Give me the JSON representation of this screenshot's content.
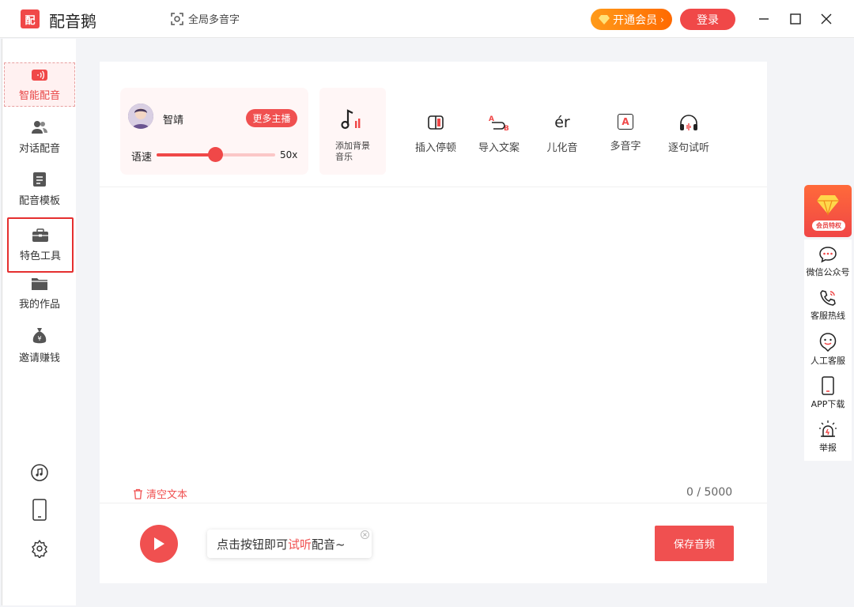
{
  "app": {
    "logo_text": "配",
    "title": "配音鹅"
  },
  "toolbar": {
    "multi_char_label": "全局多音字",
    "vip_label": "开通会员",
    "login_label": "登录"
  },
  "sidebar": {
    "items": [
      {
        "label": "智能配音"
      },
      {
        "label": "对话配音"
      },
      {
        "label": "配音模板"
      },
      {
        "label": "特色工具"
      },
      {
        "label": "我的作品"
      },
      {
        "label": "邀请赚钱"
      }
    ]
  },
  "voice": {
    "name": "智靖",
    "more_label": "更多主播",
    "speed_label": "语速",
    "speed_value": "50x",
    "speed_fraction": 0.5
  },
  "bgm": {
    "label": "添加背景音乐"
  },
  "tools": [
    {
      "label": "插入停顿"
    },
    {
      "label": "导入文案"
    },
    {
      "label": "儿化音",
      "glyph": "ér"
    },
    {
      "label": "多音字",
      "glyph": "A"
    },
    {
      "label": "逐句试听"
    }
  ],
  "editor": {
    "clear_label": "清空文本",
    "counter": "0 / 5000"
  },
  "player": {
    "hint_prefix": "点击按钮即可",
    "hint_highlight": "试听",
    "hint_suffix": "配音~",
    "save_label": "保存音频"
  },
  "rail": {
    "vip_privilege_label": "会员特权",
    "items": [
      {
        "label": "微信公众号"
      },
      {
        "label": "客服热线"
      },
      {
        "label": "人工客服"
      },
      {
        "label": "APP下载"
      },
      {
        "label": "举报"
      }
    ]
  },
  "colors": {
    "accent": "#f04848",
    "vip": "#ff7a0a"
  }
}
